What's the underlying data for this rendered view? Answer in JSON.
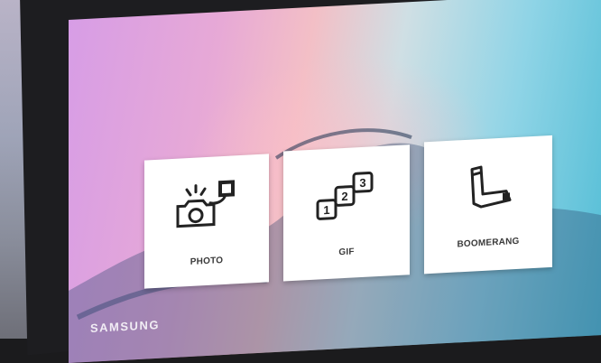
{
  "menu": {
    "tiles": [
      {
        "label": "PHOTO",
        "icon": "camera-photos-icon"
      },
      {
        "label": "GIF",
        "icon": "numbered-frames-icon",
        "frames": [
          "1",
          "2",
          "3"
        ]
      },
      {
        "label": "BOOMERANG",
        "icon": "boomerang-icon"
      }
    ]
  },
  "branding": {
    "name": "SAMSUNG"
  },
  "colors": {
    "tile": "#ffffff",
    "label": "#3a3a3a",
    "bezel": "#1d1d20"
  }
}
